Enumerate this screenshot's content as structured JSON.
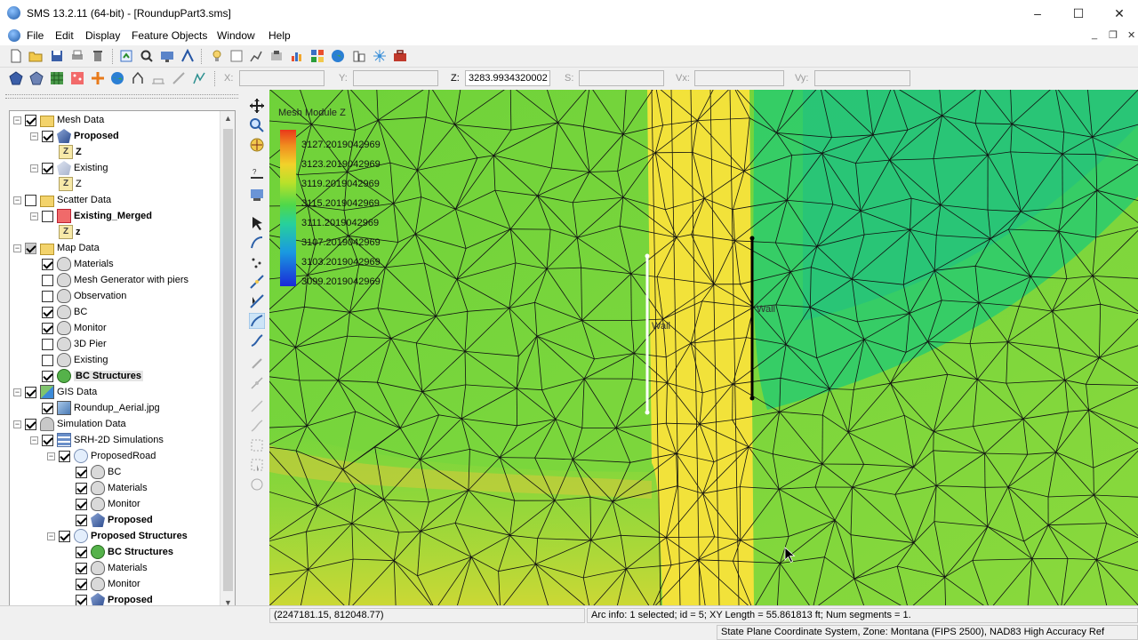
{
  "window": {
    "title": "SMS 13.2.11 (64-bit) - [RoundupPart3.sms]",
    "minimize": "–",
    "maximize": "☐",
    "close": "✕"
  },
  "menu": {
    "items": [
      "File",
      "Edit",
      "Display",
      "Feature Objects",
      "Window",
      "Help"
    ],
    "mdi_minimize": "_",
    "mdi_restore": "❐",
    "mdi_close": "✕"
  },
  "coords": {
    "x_label": "X:",
    "x_value": "",
    "y_label": "Y:",
    "y_value": "",
    "z_label": "Z:",
    "z_value": "3283.9934320002",
    "s_label": "S:",
    "s_value": "",
    "vx_label": "Vx:",
    "vx_value": "",
    "vy_label": "Vy:",
    "vy_value": ""
  },
  "tree": {
    "items": [
      {
        "label": "Mesh Data",
        "level": 0,
        "icon": "folder-mesh",
        "checked": true,
        "expand": "−",
        "bold": false
      },
      {
        "label": "Proposed",
        "level": 1,
        "icon": "mesh",
        "checked": true,
        "expand": "−",
        "bold": true
      },
      {
        "label": "Z",
        "level": 2,
        "icon": "z",
        "checked": null,
        "expand": "",
        "bold": true
      },
      {
        "label": "Existing",
        "level": 1,
        "icon": "mesh-light",
        "checked": true,
        "expand": "−",
        "bold": false
      },
      {
        "label": "Z",
        "level": 2,
        "icon": "z",
        "checked": null,
        "expand": "",
        "bold": false
      },
      {
        "label": "Scatter Data",
        "level": 0,
        "icon": "folder",
        "checked": false,
        "expand": "−",
        "bold": false
      },
      {
        "label": "Existing_Merged",
        "level": 1,
        "icon": "scatter",
        "checked": false,
        "expand": "−",
        "bold": true
      },
      {
        "label": "z",
        "level": 2,
        "icon": "z",
        "checked": null,
        "expand": "",
        "bold": true
      },
      {
        "label": "Map Data",
        "level": 0,
        "icon": "folder",
        "checked": "gray",
        "expand": "−",
        "bold": false
      },
      {
        "label": "Materials",
        "level": 1,
        "icon": "cov",
        "checked": true,
        "expand": "",
        "bold": false
      },
      {
        "label": "Mesh Generator with piers",
        "level": 1,
        "icon": "cov",
        "checked": false,
        "expand": "",
        "bold": false
      },
      {
        "label": "Observation",
        "level": 1,
        "icon": "cov",
        "checked": false,
        "expand": "",
        "bold": false
      },
      {
        "label": "BC",
        "level": 1,
        "icon": "cov",
        "checked": true,
        "expand": "",
        "bold": false
      },
      {
        "label": "Monitor",
        "level": 1,
        "icon": "cov",
        "checked": true,
        "expand": "",
        "bold": false
      },
      {
        "label": "3D Pier",
        "level": 1,
        "icon": "cov",
        "checked": false,
        "expand": "",
        "bold": false
      },
      {
        "label": "Existing",
        "level": 1,
        "icon": "cov",
        "checked": false,
        "expand": "",
        "bold": false
      },
      {
        "label": "BC Structures",
        "level": 1,
        "icon": "cov-green",
        "checked": true,
        "expand": "",
        "bold": true,
        "selected": true
      },
      {
        "label": "GIS Data",
        "level": 0,
        "icon": "gis",
        "checked": true,
        "expand": "−",
        "bold": false
      },
      {
        "label": "Roundup_Aerial.jpg",
        "level": 1,
        "icon": "img",
        "checked": true,
        "expand": "",
        "bold": false
      },
      {
        "label": "Simulation Data",
        "level": 0,
        "icon": "sim",
        "checked": true,
        "expand": "−",
        "bold": false
      },
      {
        "label": "SRH-2D Simulations",
        "level": 1,
        "icon": "simlist",
        "checked": true,
        "expand": "−",
        "bold": false
      },
      {
        "label": "ProposedRoad",
        "level": 2,
        "icon": "sub",
        "checked": true,
        "expand": "−",
        "bold": false
      },
      {
        "label": "BC",
        "level": 3,
        "icon": "cov",
        "checked": true,
        "expand": "",
        "bold": false
      },
      {
        "label": "Materials",
        "level": 3,
        "icon": "cov",
        "checked": true,
        "expand": "",
        "bold": false
      },
      {
        "label": "Monitor",
        "level": 3,
        "icon": "cov",
        "checked": true,
        "expand": "",
        "bold": false
      },
      {
        "label": "Proposed",
        "level": 3,
        "icon": "mesh",
        "checked": true,
        "expand": "",
        "bold": true
      },
      {
        "label": "Proposed Structures",
        "level": 2,
        "icon": "sub",
        "checked": true,
        "expand": "−",
        "bold": true
      },
      {
        "label": "BC Structures",
        "level": 3,
        "icon": "cov-green",
        "checked": true,
        "expand": "",
        "bold": true
      },
      {
        "label": "Materials",
        "level": 3,
        "icon": "cov",
        "checked": true,
        "expand": "",
        "bold": false
      },
      {
        "label": "Monitor",
        "level": 3,
        "icon": "cov",
        "checked": true,
        "expand": "",
        "bold": false
      },
      {
        "label": "Proposed",
        "level": 3,
        "icon": "mesh",
        "checked": true,
        "expand": "",
        "bold": true
      }
    ]
  },
  "legend": {
    "title": "Mesh Module Z",
    "labels": [
      "3127.2019042969",
      "3123.2019042969",
      "3119.2019042969",
      "3115.2019042969",
      "3111.2019042969",
      "3107.2019042969",
      "3103.2019042969",
      "3099.2019042969"
    ]
  },
  "arcs": {
    "left_label": "Wall",
    "right_label": "Wall"
  },
  "status": {
    "cursor_coords": "(2247181.15, 812048.77)",
    "arc_info": "Arc info: 1 selected; id = 5; XY Length = 55.861813 ft; Num segments = 1.",
    "projection": "State Plane Coordinate System, Zone: Montana (FIPS 2500), NAD83 High Accuracy Ref"
  },
  "colors": {
    "selected_arc": "#ffffff",
    "wall_arc": "#000000",
    "road": "#f2e23a"
  }
}
